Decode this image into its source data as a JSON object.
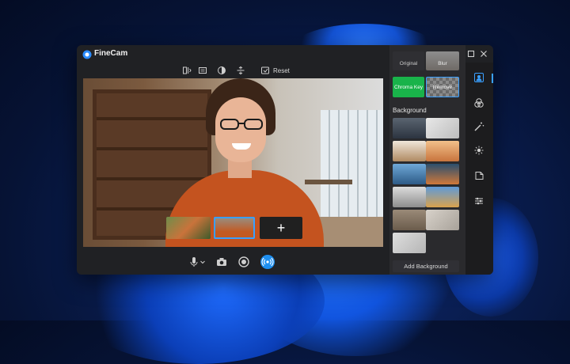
{
  "app": {
    "title": "FineCam"
  },
  "toolbar": {
    "reset_label": "Reset"
  },
  "effects_panel": {
    "presets": [
      {
        "label": "Original"
      },
      {
        "label": "Blur"
      },
      {
        "label": "Chroma Key"
      },
      {
        "label": "Remove"
      }
    ],
    "background_title": "Background",
    "add_background_label": "Add Background"
  },
  "colors": {
    "accent": "#3aa0ff",
    "chroma_key": "#19b34a",
    "window_bg": "#202124",
    "panel_bg": "#2a2a2d"
  },
  "icons": {
    "titlebar": [
      "menu-icon",
      "minimize-icon",
      "maximize-icon",
      "close-icon"
    ],
    "toolbar": [
      "mirror-icon",
      "aspect-ratio-icon",
      "contrast-icon",
      "flip-icon",
      "reset-icon"
    ],
    "bottom_bar": [
      "microphone-icon",
      "chevron-down-icon",
      "camera-icon",
      "record-icon",
      "live-stream-icon"
    ],
    "right_rail": [
      "portrait-icon",
      "filters-icon",
      "magic-wand-icon",
      "ai-effects-icon",
      "sticker-icon",
      "settings-sliders-icon"
    ]
  }
}
